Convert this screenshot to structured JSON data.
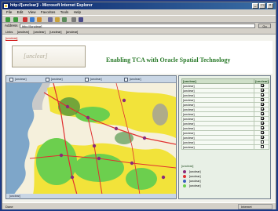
{
  "browser": {
    "title": "http://[unclear]/ - Microsoft Internet Explorer",
    "menu": [
      "File",
      "Edit",
      "View",
      "Favorites",
      "Tools",
      "Help"
    ],
    "address_label": "Address",
    "address_value": "http://[unclear]",
    "go_label": "Go",
    "links": [
      "Links",
      "[unclear]",
      "[unclear]",
      "[unclear]",
      "[unclear]"
    ],
    "status_text": "Done",
    "zone_text": "Internet"
  },
  "page": {
    "top_link": "[unclear]",
    "logo_text": "[unclear]",
    "title": "Enabling TCA with Oracle Spatial Technology"
  },
  "map": {
    "tools": [
      "[unclear]",
      "[unclear]",
      "[unclear]",
      "[unclear]"
    ],
    "status": "[unclear]",
    "colors": {
      "ocean": "#7ea6c9",
      "land": "#f5f0dc",
      "yellow": "#f2e33a",
      "green": "#6ccf4e",
      "dark_green": "#3d8a3a",
      "gray": "#9e9e9e",
      "road": "#e03030",
      "marker": "#8a2a7a"
    }
  },
  "layers": {
    "header_name": "[unclear]",
    "header_display": "[unclear]",
    "rows": [
      {
        "name": "[unclear]",
        "checked": true
      },
      {
        "name": "[unclear]",
        "checked": true
      },
      {
        "name": "[unclear]",
        "checked": true
      },
      {
        "name": "[unclear]",
        "checked": true
      },
      {
        "name": "[unclear]",
        "checked": true
      },
      {
        "name": "[unclear]",
        "checked": true
      },
      {
        "name": "[unclear]",
        "checked": true
      },
      {
        "name": "[unclear]",
        "checked": true
      },
      {
        "name": "[unclear]",
        "checked": true
      },
      {
        "name": "[unclear]",
        "checked": true
      },
      {
        "name": "[unclear]",
        "checked": true
      },
      {
        "name": "[unclear]",
        "checked": true
      },
      {
        "name": "[unclear]",
        "checked": false
      },
      {
        "name": "[unclear]",
        "checked": false
      }
    ]
  },
  "legend": {
    "title": "[unclear]",
    "items": [
      {
        "label": "[unclear]",
        "color": "#8a2a7a"
      },
      {
        "label": "[unclear]",
        "color": "#e03030"
      },
      {
        "label": "[unclear]",
        "color": "#3b5fc0"
      },
      {
        "label": "[unclear]",
        "color": "#6ccf4e"
      }
    ]
  }
}
